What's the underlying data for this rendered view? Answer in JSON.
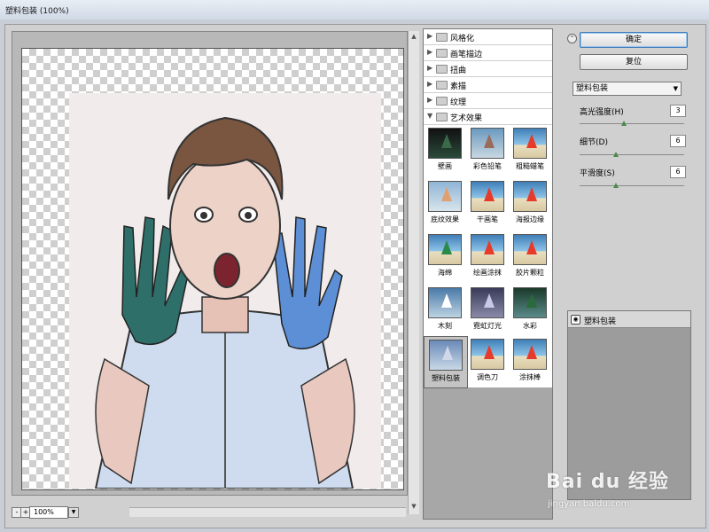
{
  "window": {
    "title": "塑料包装 (100%)"
  },
  "zoom": {
    "value": "100%",
    "minus": "-",
    "plus": "+"
  },
  "filter_categories": [
    {
      "label": "风格化",
      "expanded": false
    },
    {
      "label": "画笔描边",
      "expanded": false
    },
    {
      "label": "扭曲",
      "expanded": false
    },
    {
      "label": "素描",
      "expanded": false
    },
    {
      "label": "纹理",
      "expanded": false
    },
    {
      "label": "艺术效果",
      "expanded": true
    }
  ],
  "filter_thumbnails": [
    {
      "label": "壁画"
    },
    {
      "label": "彩色铅笔"
    },
    {
      "label": "粗糙蜡笔"
    },
    {
      "label": "底纹效果"
    },
    {
      "label": "干画笔"
    },
    {
      "label": "海报边缘"
    },
    {
      "label": "海绵"
    },
    {
      "label": "绘画涂抹"
    },
    {
      "label": "胶片颗粒"
    },
    {
      "label": "木刻"
    },
    {
      "label": "霓虹灯光"
    },
    {
      "label": "水彩"
    },
    {
      "label": "塑料包装",
      "selected": true
    },
    {
      "label": "调色刀"
    },
    {
      "label": "涂抹棒"
    }
  ],
  "buttons": {
    "ok": "确定",
    "reset": "复位"
  },
  "filter_select": {
    "value": "塑料包装"
  },
  "params": [
    {
      "label": "高光强度(H)",
      "value": "3",
      "fraction": 0.42
    },
    {
      "label": "细节(D)",
      "value": "6",
      "fraction": 0.35
    },
    {
      "label": "平滑度(S)",
      "value": "6",
      "fraction": 0.35
    }
  ],
  "layers": [
    {
      "label": "塑料包装"
    }
  ],
  "watermark": {
    "logo": "Bai du 经验",
    "url": "jingyan.baidu.com"
  },
  "colors": {
    "accent": "#3d7bbd",
    "panel": "#d0d0d0",
    "list_bg": "#a7a7a7"
  }
}
